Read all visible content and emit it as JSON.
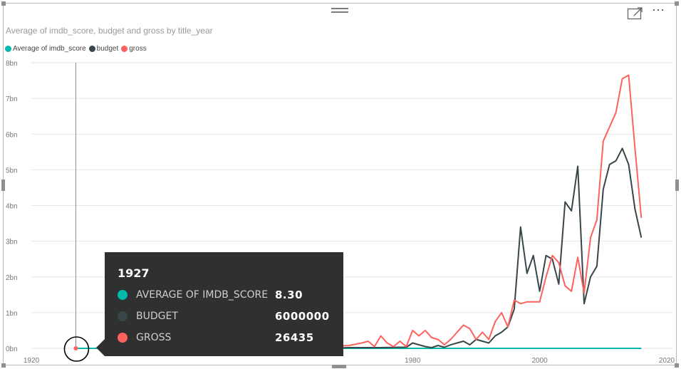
{
  "visual": {
    "title": "Average of imdb_score, budget and gross by title_year",
    "more_glyph": "⋯"
  },
  "legend": [
    {
      "label": "Average of imdb_score",
      "color": "#01b8aa"
    },
    {
      "label": "budget",
      "color": "#374649"
    },
    {
      "label": "gross",
      "color": "#fd625e"
    }
  ],
  "tooltip": {
    "year": "1927",
    "rows": [
      {
        "label": "AVERAGE OF IMDB_SCORE",
        "value": "8.30",
        "color": "#01b8aa"
      },
      {
        "label": "BUDGET",
        "value": "6000000",
        "color": "#374649"
      },
      {
        "label": "GROSS",
        "value": "26435",
        "color": "#fd625e"
      }
    ]
  },
  "chart_data": {
    "type": "line",
    "xlabel": "",
    "ylabel": "",
    "xlim": [
      1920,
      2020
    ],
    "ylim": [
      0,
      8
    ],
    "y_unit": "bn",
    "x_ticks": [
      1920,
      1940,
      1960,
      1980,
      2000,
      2020
    ],
    "x_tick_labels": [
      "1920",
      "",
      "",
      "1980",
      "2000",
      "2020"
    ],
    "y_ticks": [
      0,
      1,
      2,
      3,
      4,
      5,
      6,
      7,
      8
    ],
    "y_tick_labels": [
      "0bn",
      "1bn",
      "2bn",
      "3bn",
      "4bn",
      "5bn",
      "6bn",
      "7bn",
      "8bn"
    ],
    "grid": true,
    "legend_position": "top-left",
    "hover_year": 1927,
    "series": [
      {
        "name": "Average of imdb_score",
        "color": "#01b8aa",
        "x": [
          1927,
          2016
        ],
        "y": [
          0,
          0
        ]
      },
      {
        "name": "budget",
        "color": "#374649",
        "x": [
          1966,
          1970,
          1975,
          1978,
          1979,
          1980,
          1981,
          1982,
          1983,
          1984,
          1985,
          1986,
          1987,
          1988,
          1989,
          1990,
          1991,
          1992,
          1993,
          1994,
          1995,
          1996,
          1997,
          1998,
          1999,
          2000,
          2001,
          2002,
          2003,
          2004,
          2005,
          2006,
          2007,
          2008,
          2009,
          2010,
          2011,
          2012,
          2013,
          2014,
          2015,
          2016
        ],
        "y": [
          0,
          0.02,
          0.02,
          0.03,
          0.03,
          0.15,
          0.1,
          0.05,
          0.02,
          0.08,
          0.03,
          0.1,
          0.15,
          0.2,
          0.1,
          0.25,
          0.2,
          0.15,
          0.35,
          0.45,
          0.6,
          1.1,
          3.4,
          2.1,
          2.6,
          1.6,
          2.6,
          2.5,
          1.8,
          4.1,
          3.85,
          5.1,
          1.25,
          2.0,
          2.3,
          4.45,
          5.15,
          5.25,
          5.6,
          5.15,
          3.9,
          3.1
        ]
      },
      {
        "name": "gross",
        "color": "#fd625e",
        "x": [
          1966,
          1970,
          1972,
          1973,
          1974,
          1975,
          1976,
          1977,
          1978,
          1979,
          1980,
          1981,
          1982,
          1983,
          1984,
          1985,
          1986,
          1987,
          1988,
          1989,
          1990,
          1991,
          1992,
          1993,
          1994,
          1995,
          1996,
          1997,
          1998,
          1999,
          2000,
          2001,
          2002,
          2003,
          2004,
          2005,
          2006,
          2007,
          2008,
          2009,
          2010,
          2011,
          2012,
          2013,
          2014,
          2015,
          2016
        ],
        "y": [
          0.05,
          0.08,
          0.15,
          0.2,
          0.05,
          0.35,
          0.15,
          0.05,
          0.2,
          0.05,
          0.5,
          0.35,
          0.5,
          0.3,
          0.25,
          0.1,
          0.25,
          0.45,
          0.65,
          0.55,
          0.25,
          0.45,
          0.25,
          0.75,
          1.0,
          0.6,
          1.35,
          1.25,
          1.3,
          1.3,
          1.3,
          2.0,
          2.6,
          2.4,
          1.75,
          1.6,
          2.55,
          1.55,
          3.1,
          3.6,
          5.8,
          6.2,
          6.6,
          7.55,
          7.65,
          5.6,
          3.65
        ]
      }
    ]
  }
}
